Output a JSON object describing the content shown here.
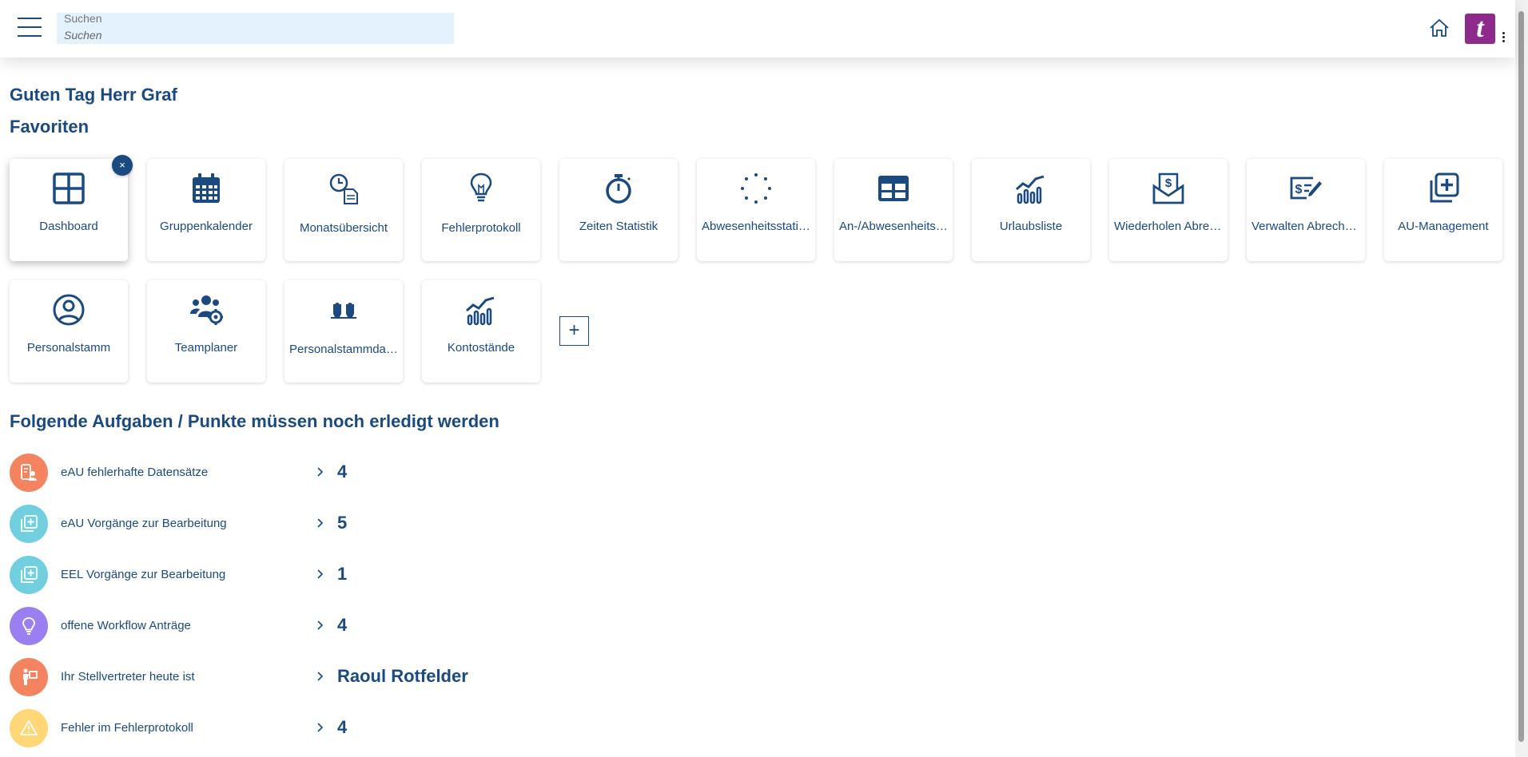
{
  "header": {
    "search_label": "Suchen",
    "search_placeholder": "Suchen",
    "logo_letter": "t",
    "brand_color": "#8e2a8c"
  },
  "greeting": "Guten Tag Herr Graf",
  "favorites_title": "Favoriten",
  "remove_symbol": "×",
  "add_symbol": "+",
  "tiles": [
    {
      "label": "Dashboard",
      "icon": "dashboard-icon"
    },
    {
      "label": "Gruppenkalender",
      "icon": "calendar-icon"
    },
    {
      "label": "Monatsübersicht",
      "icon": "clock-document-icon"
    },
    {
      "label": "Fehlerprotokoll",
      "icon": "lightbulb-icon"
    },
    {
      "label": "Zeiten Statistik",
      "icon": "stopwatch-icon"
    },
    {
      "label": "Abwesenheitsstatistik",
      "icon": "loading-dots-icon"
    },
    {
      "label": "An-/Abwesenheitsübersicht",
      "icon": "table-icon"
    },
    {
      "label": "Urlaubsliste",
      "icon": "chart-icon"
    },
    {
      "label": "Wiederholen Abrechnung",
      "icon": "payslip-envelope-icon"
    },
    {
      "label": "Verwalten Abrechnung",
      "icon": "check-edit-icon"
    },
    {
      "label": "AU-Management",
      "icon": "add-copy-icon"
    },
    {
      "label": "Personalstamm",
      "icon": "user-circle-icon"
    },
    {
      "label": "Teamplaner",
      "icon": "team-gear-icon"
    },
    {
      "label": "Personalstammdaten",
      "icon": "persons-icon"
    },
    {
      "label": "Kontostände",
      "icon": "chart-icon"
    }
  ],
  "tasks_title": "Folgende Aufgaben / Punkte müssen noch erledigt werden",
  "tasks": [
    {
      "label": "eAU fehlerhafte Datensätze",
      "value": "4",
      "color": "#f4845f",
      "icon": "id-card-icon"
    },
    {
      "label": "eAU Vorgänge zur Bearbeitung",
      "value": "5",
      "color": "#72cfe0",
      "icon": "add-copy-icon"
    },
    {
      "label": "EEL Vorgänge zur Bearbeitung",
      "value": "1",
      "color": "#72cfe0",
      "icon": "add-copy-icon"
    },
    {
      "label": "offene Workflow Anträge",
      "value": "4",
      "color": "#9b7ff0",
      "icon": "lightbulb-icon"
    },
    {
      "label": "Ihr Stellvertreter heute ist",
      "value": "Raoul Rotfelder",
      "color": "#f4845f",
      "icon": "person-board-icon"
    },
    {
      "label": "Fehler im Fehlerprotokoll",
      "value": "4",
      "color": "#ffd777",
      "icon": "warning-icon"
    }
  ]
}
